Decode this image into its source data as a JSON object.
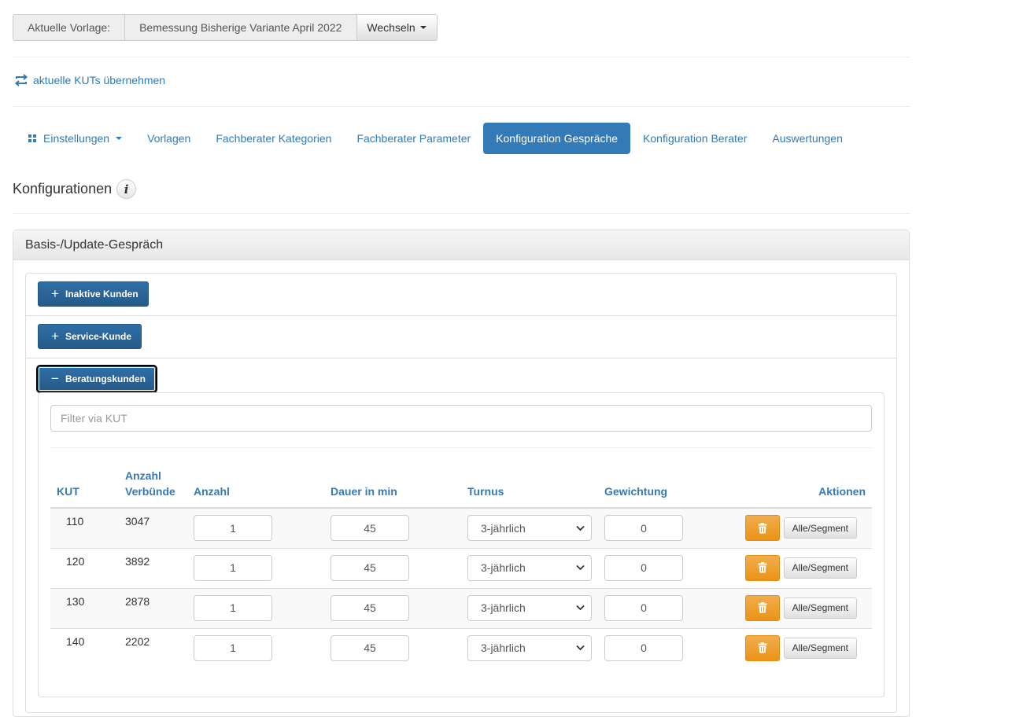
{
  "template_bar": {
    "label": "Aktuelle Vorlage:",
    "value": "Bemessung Bisherige Variante April 2022",
    "switch_label": "Wechseln"
  },
  "kut_link": "aktuelle KUTs übernehmen",
  "nav": {
    "settings": "Einstellungen",
    "items": [
      "Vorlagen",
      "Fachberater Kategorien",
      "Fachberater Parameter",
      "Konfiguration Gespräche",
      "Konfiguration Berater",
      "Auswertungen"
    ],
    "active": "Konfiguration Gespräche"
  },
  "section_title": "Konfigurationen",
  "panel": {
    "title": "Basis-/Update-Gespräch",
    "groups": [
      {
        "label": "Inaktive Kunden",
        "symbol": "+"
      },
      {
        "label": "Service-Kunde",
        "symbol": "+"
      },
      {
        "label": "Beratungskunden",
        "symbol": "−"
      }
    ]
  },
  "filter_placeholder": "Filter via KUT",
  "table": {
    "headers": {
      "kut": "KUT",
      "verbuende_1": "Anzahl",
      "verbuende_2": "Verbünde",
      "anzahl": "Anzahl",
      "dauer": "Dauer in min",
      "turnus": "Turnus",
      "gewichtung": "Gewichtung",
      "aktionen": "Aktionen"
    },
    "rows": [
      {
        "kut": "110",
        "verbuende": "3047",
        "anzahl": "1",
        "dauer": "45",
        "turnus": "3-jährlich",
        "gewichtung": "0"
      },
      {
        "kut": "120",
        "verbuende": "3892",
        "anzahl": "1",
        "dauer": "45",
        "turnus": "3-jährlich",
        "gewichtung": "0"
      },
      {
        "kut": "130",
        "verbuende": "2878",
        "anzahl": "1",
        "dauer": "45",
        "turnus": "3-jährlich",
        "gewichtung": "0"
      },
      {
        "kut": "140",
        "verbuende": "2202",
        "anzahl": "1",
        "dauer": "45",
        "turnus": "3-jährlich",
        "gewichtung": "0"
      }
    ],
    "segment_label": "Alle/Segment"
  },
  "colors": {
    "primary": "#337ab7",
    "warning": "#f0ad4e",
    "group_button": "#265a88"
  }
}
